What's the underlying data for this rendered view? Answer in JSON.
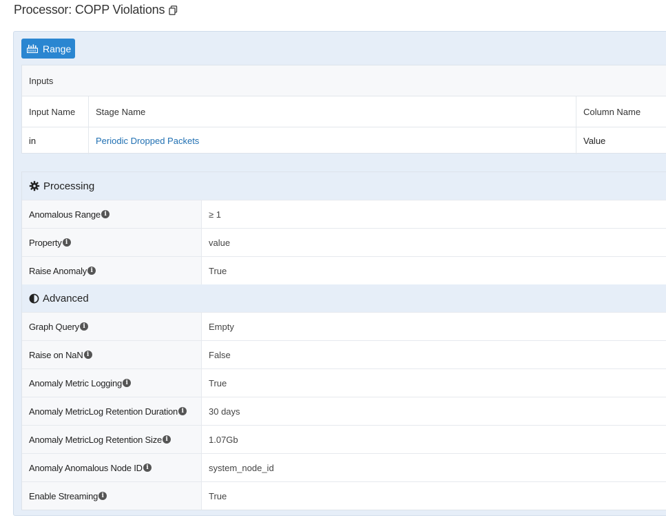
{
  "header": {
    "title": "Processor: COPP Violations",
    "copy_icon": "copy-icon"
  },
  "range_button": {
    "label": "Range",
    "icon": "range-icon",
    "color": "#2a86d1"
  },
  "inputs": {
    "title": "Inputs",
    "columns": [
      "Input Name",
      "Stage Name",
      "Column Name"
    ],
    "rows": [
      {
        "input_name": "in",
        "stage_name": "Periodic Dropped Packets",
        "column_name": "Value"
      }
    ]
  },
  "processing": {
    "title": "Processing",
    "icon": "gear-icon",
    "rows": [
      {
        "key": "Anomalous Range",
        "value": "≥ 1"
      },
      {
        "key": "Property",
        "value": "value"
      },
      {
        "key": "Raise Anomaly",
        "value": "True"
      }
    ]
  },
  "advanced": {
    "title": "Advanced",
    "icon": "half-circle-icon",
    "rows": [
      {
        "key": "Graph Query",
        "value": "Empty"
      },
      {
        "key": "Raise on NaN",
        "value": "False"
      },
      {
        "key": "Anomaly Metric Logging",
        "value": "True"
      },
      {
        "key": "Anomaly MetricLog Retention Duration",
        "value": "30 days"
      },
      {
        "key": "Anomaly MetricLog Retention Size",
        "value": "1.07Gb"
      },
      {
        "key": "Anomaly Anomalous Node ID",
        "value": "system_node_id"
      },
      {
        "key": "Enable Streaming",
        "value": "True"
      }
    ]
  }
}
